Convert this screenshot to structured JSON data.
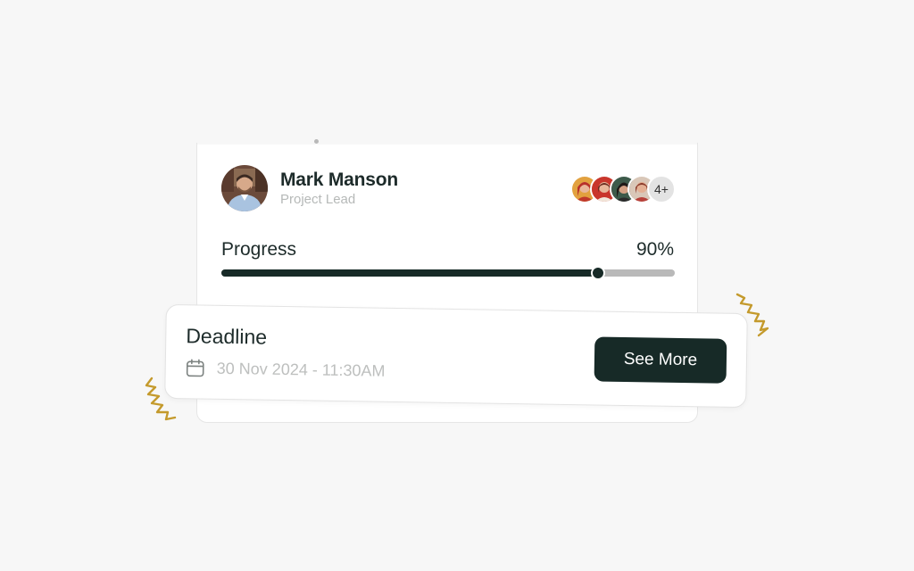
{
  "user": {
    "name": "Mark Manson",
    "role": "Project Lead"
  },
  "team": {
    "more_label": "4+"
  },
  "progress": {
    "label": "Progress",
    "value_text": "90%",
    "value": 0.83
  },
  "deadline": {
    "title": "Deadline",
    "date": "30 Nov 2024 - 11:30AM",
    "button_label": "See More"
  },
  "colors": {
    "accent": "#172a27",
    "track": "#b9b9b9",
    "squiggle": "#c49a2c",
    "background": "#f7f7f7"
  },
  "icons": [
    "calendar-icon"
  ]
}
